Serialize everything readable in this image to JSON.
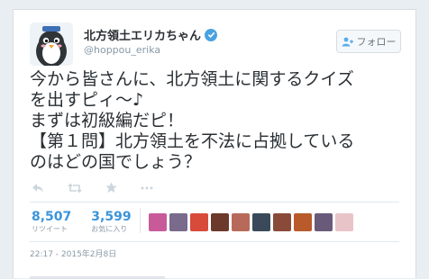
{
  "tweet": {
    "author": {
      "display_name": "北方領土エリカちゃん",
      "screen_name": "@hoppou_erika",
      "verified": true
    },
    "follow_button": {
      "label": "フォロー",
      "icon": "add-user-icon"
    },
    "text_lines": [
      "今から皆さんに、北方領土に関するクイズ",
      "を出すピィ～♪",
      "まずは初級編だピ！",
      "【第１問】北方領土を不法に占拠している",
      "のはどの国でしょう？"
    ],
    "actions": [
      "reply-icon",
      "retweet-icon",
      "favorite-icon",
      "more-icon"
    ],
    "stats": {
      "retweets": {
        "count": "8,507",
        "label": "リツイート"
      },
      "favorites": {
        "count": "3,599",
        "label": "お気に入り"
      }
    },
    "favoriter_avatars": [
      "#c85a9a",
      "#7a6a8c",
      "#d84a3a",
      "#6b3a2a",
      "#b86a5a",
      "#3a4a5a",
      "#8a4a3a",
      "#b85a2a",
      "#6a5a7a",
      "#e8c4c8"
    ],
    "timestamp": "22:17 - 2015年2月8日",
    "colors": {
      "link": "#3b94d9",
      "muted": "#8899a6",
      "verified": "#4aa3df"
    }
  }
}
